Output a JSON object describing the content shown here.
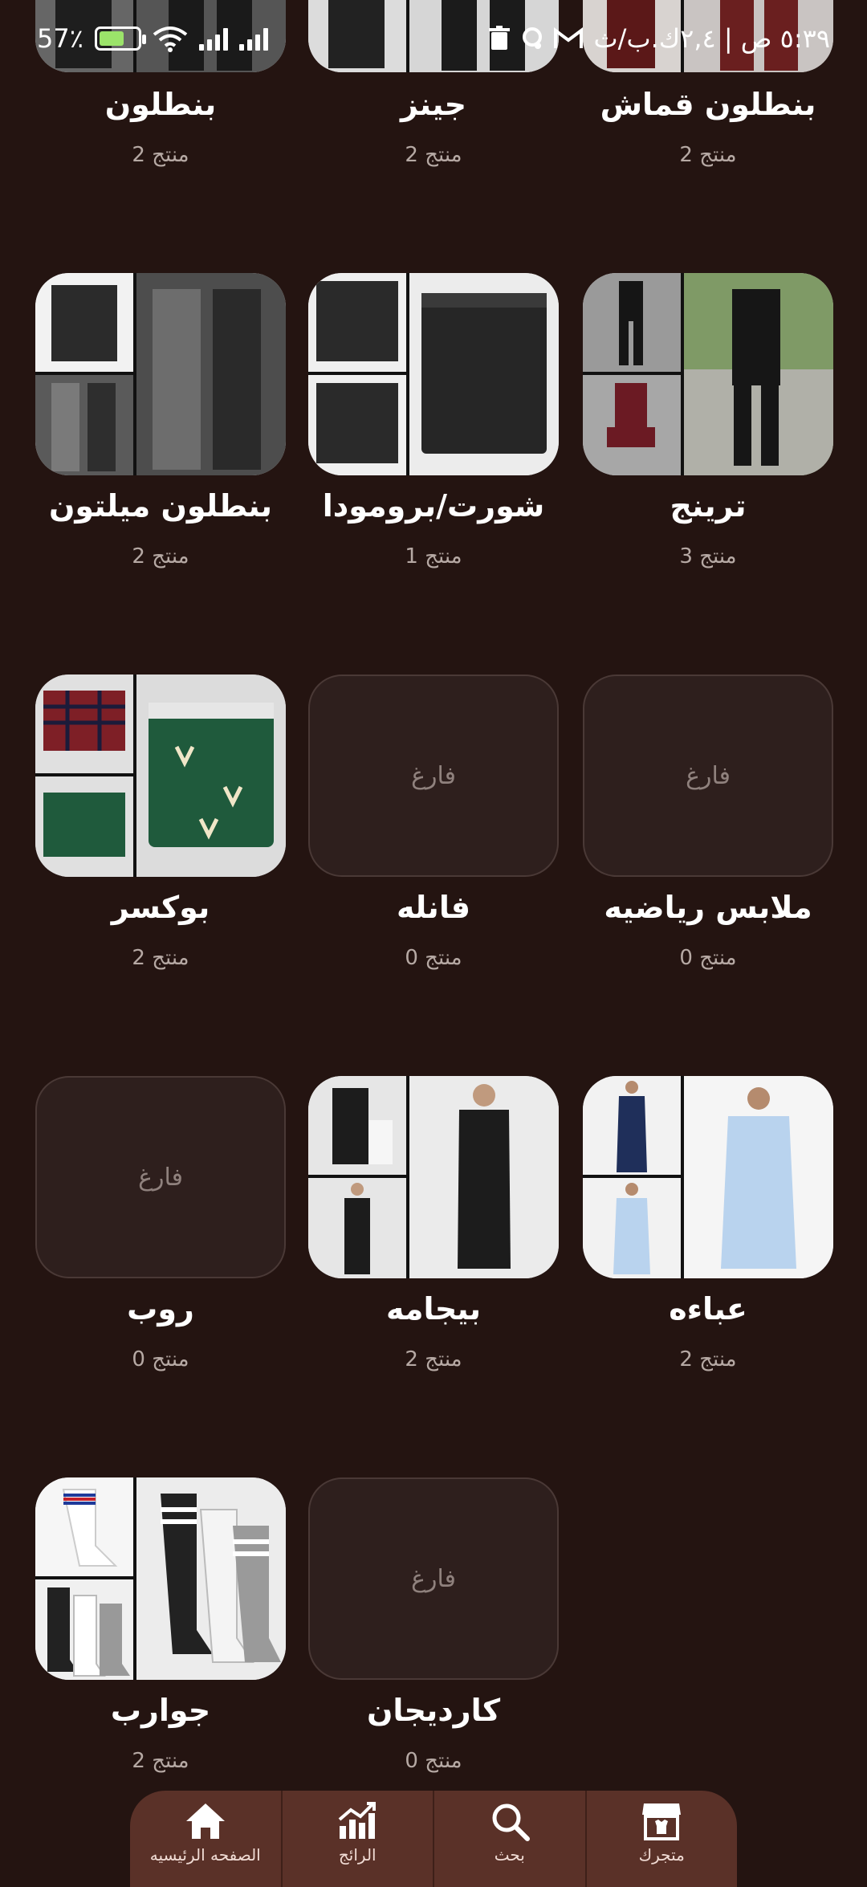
{
  "status_bar": {
    "time": "٥:٣٩ ص | ٢,٤ك.ب/ث",
    "battery_percent": "57٪",
    "icons": [
      "gmail-icon",
      "notification-icon",
      "trash-icon",
      "signal-icon",
      "signal-icon",
      "wifi-icon",
      "battery-charging-icon"
    ]
  },
  "categories": [
    {
      "name": "بنطلون قماش",
      "count": "2 منتج",
      "image": "collage"
    },
    {
      "name": "جينز",
      "count": "2 منتج",
      "image": "collage"
    },
    {
      "name": "بنطلون",
      "count": "2 منتج",
      "image": "collage"
    },
    {
      "name": "ترينج",
      "count": "3 منتج",
      "image": "collage"
    },
    {
      "name": "شورت/برومودا",
      "count": "1 منتج",
      "image": "collage"
    },
    {
      "name": "بنطلون ميلتون",
      "count": "2 منتج",
      "image": "collage"
    },
    {
      "name": "ملابس رياضيه",
      "count": "0 منتج",
      "image": "empty",
      "empty_label": "فارغ"
    },
    {
      "name": "فانله",
      "count": "0 منتج",
      "image": "empty",
      "empty_label": "فارغ"
    },
    {
      "name": "بوكسر",
      "count": "2 منتج",
      "image": "collage"
    },
    {
      "name": "عباءه",
      "count": "2 منتج",
      "image": "collage"
    },
    {
      "name": "بيجامه",
      "count": "2 منتج",
      "image": "collage"
    },
    {
      "name": "روب",
      "count": "0 منتج",
      "image": "empty",
      "empty_label": "فارغ"
    },
    {
      "name": "كارديجان",
      "count": "0 منتج",
      "image": "empty",
      "empty_label": "فارغ"
    },
    {
      "name": "جوارب",
      "count": "2 منتج",
      "image": "collage"
    }
  ],
  "bottom_nav": {
    "items": [
      {
        "label": "متجرك",
        "icon": "store-icon"
      },
      {
        "label": "بحث",
        "icon": "search-icon"
      },
      {
        "label": "الرائج",
        "icon": "trending-chart-icon"
      },
      {
        "label": "الصفحه الرئيسيه",
        "icon": "home-icon"
      }
    ]
  },
  "colors": {
    "background": "#241411",
    "nav_background": "#5a3128",
    "empty_tile": "#2e1f1d"
  }
}
